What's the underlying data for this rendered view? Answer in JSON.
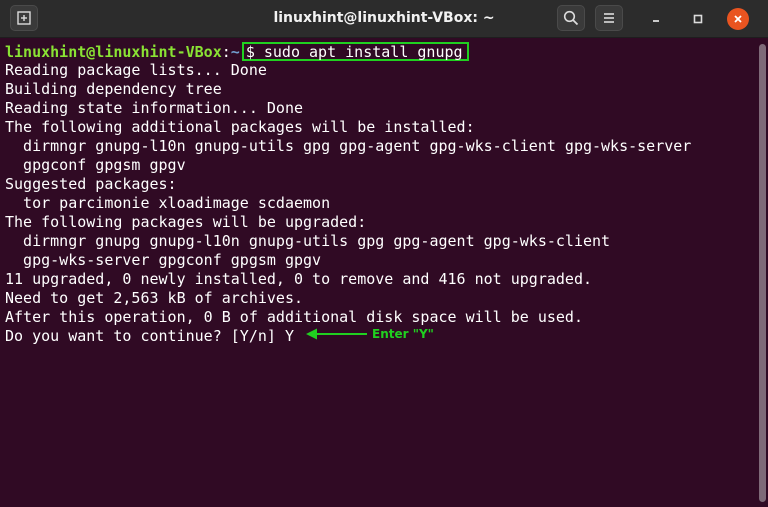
{
  "window": {
    "title": "linuxhint@linuxhint-VBox: ~"
  },
  "titlebar": {
    "new_tab_icon": "new-tab-icon",
    "search_icon": "search-icon",
    "menu_icon": "hamburger-menu-icon",
    "minimize_icon": "minimize-icon",
    "maximize_icon": "maximize-icon",
    "close_icon": "close-icon"
  },
  "terminal": {
    "prompt": {
      "user_host": "linuxhint@linuxhint-VBox",
      "colon": ":",
      "path": "~",
      "symbol": "$",
      "command": "sudo apt install gnupg"
    },
    "lines": [
      "Reading package lists... Done",
      "Building dependency tree",
      "Reading state information... Done",
      "The following additional packages will be installed:",
      "  dirmngr gnupg-l10n gnupg-utils gpg gpg-agent gpg-wks-client gpg-wks-server",
      "  gpgconf gpgsm gpgv",
      "Suggested packages:",
      "  tor parcimonie xloadimage scdaemon",
      "The following packages will be upgraded:",
      "  dirmngr gnupg gnupg-l10n gnupg-utils gpg gpg-agent gpg-wks-client",
      "  gpg-wks-server gpgconf gpgsm gpgv",
      "11 upgraded, 0 newly installed, 0 to remove and 416 not upgraded.",
      "Need to get 2,563 kB of archives.",
      "After this operation, 0 B of additional disk space will be used.",
      "Do you want to continue? [Y/n] Y"
    ],
    "annotation": "Enter \"Y\""
  },
  "colors": {
    "terminal_bg": "#300a24",
    "titlebar_bg": "#2c2c2c",
    "highlight_green": "#20d020",
    "prompt_user": "#8ae234",
    "prompt_path": "#729fcf",
    "close_button": "#e95420"
  }
}
